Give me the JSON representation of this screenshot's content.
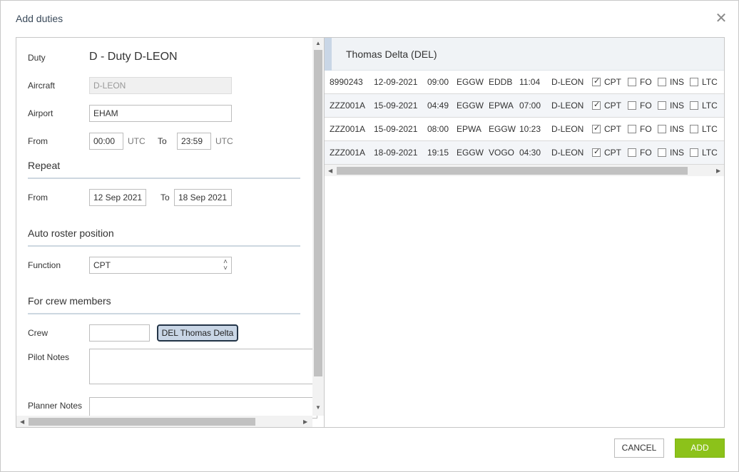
{
  "dialog": {
    "title": "Add duties"
  },
  "form": {
    "duty_label": "Duty",
    "duty_value": "D - Duty D-LEON",
    "aircraft_label": "Aircraft",
    "aircraft_value": "D-LEON",
    "airport_label": "Airport",
    "airport_value": "EHAM",
    "from_label": "From",
    "from_value": "00:00",
    "utc1": "UTC",
    "to_label": "To",
    "to_value": "23:59",
    "utc2": "UTC",
    "repeat_heading": "Repeat",
    "repeat_from_label": "From",
    "repeat_from_value": "12 Sep 2021",
    "repeat_to_label": "To",
    "repeat_to_value": "18 Sep 2021",
    "auto_roster_heading": "Auto roster position",
    "function_label": "Function",
    "function_value": "CPT",
    "crew_heading": "For crew members",
    "crew_label": "Crew",
    "crew_input_value": "",
    "crew_chip": "DEL Thomas Delta",
    "pilot_notes_label": "Pilot Notes",
    "planner_notes_label": "Planner Notes"
  },
  "crew_panel": {
    "name": "Thomas Delta (DEL)",
    "rows": [
      {
        "flight": "8990243",
        "date": "12-09-2021",
        "dep_time": "09:00",
        "from": "EGGW",
        "to": "EDDB",
        "arr_time": "11:04",
        "aircraft": "D-LEON",
        "cpt": "CPT",
        "fo": "FO",
        "ins": "INS",
        "ltc": "LTC",
        "cpt_checked": true
      },
      {
        "flight": "ZZZ001A",
        "date": "15-09-2021",
        "dep_time": "04:49",
        "from": "EGGW",
        "to": "EPWA",
        "arr_time": "07:00",
        "aircraft": "D-LEON",
        "cpt": "CPT",
        "fo": "FO",
        "ins": "INS",
        "ltc": "LTC",
        "cpt_checked": true
      },
      {
        "flight": "ZZZ001A",
        "date": "15-09-2021",
        "dep_time": "08:00",
        "from": "EPWA",
        "to": "EGGW",
        "arr_time": "10:23",
        "aircraft": "D-LEON",
        "cpt": "CPT",
        "fo": "FO",
        "ins": "INS",
        "ltc": "LTC",
        "cpt_checked": true
      },
      {
        "flight": "ZZZ001A",
        "date": "18-09-2021",
        "dep_time": "19:15",
        "from": "EGGW",
        "to": "VOGO",
        "arr_time": "04:30",
        "aircraft": "D-LEON",
        "cpt": "CPT",
        "fo": "FO",
        "ins": "INS",
        "ltc": "LTC",
        "cpt_checked": true
      }
    ]
  },
  "buttons": {
    "cancel": "CANCEL",
    "add": "ADD"
  },
  "colors": {
    "accent_green": "#8cc21a",
    "chip_bg": "#c9d6e6",
    "section_line": "#cdd7e0"
  }
}
